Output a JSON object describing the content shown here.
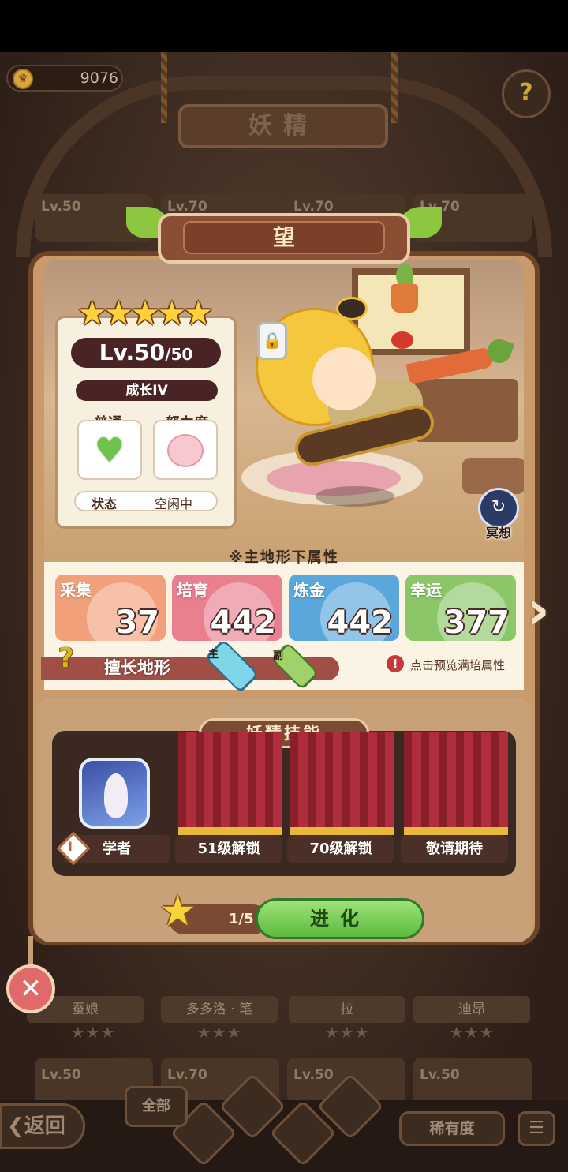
{
  "top_bar": {
    "coins": "9076"
  },
  "page_title": "妖精",
  "background_cards": {
    "top_row_levels": [
      "Lv.50",
      "Lv.70",
      "Lv.70",
      "Lv.70"
    ],
    "middle_row_names": [
      "蚕娘",
      "多多洛 · 笔",
      "拉",
      "迪昂"
    ],
    "bottom_row_levels": [
      "Lv.50",
      "Lv.70",
      "Lv.50",
      "Lv.50"
    ],
    "stars": "★★★"
  },
  "fairy": {
    "name": "望",
    "stars": "★★★★★",
    "level": "Lv.50",
    "level_max": "/50",
    "growth": "成长IV",
    "rarity_label": "普通",
    "effort_label": "努力度",
    "status_label": "状态",
    "status_value": "空闲中",
    "meditate_label": "冥想"
  },
  "attributes": {
    "header": "※主地形下属性",
    "items": [
      {
        "label": "采集",
        "value": "37",
        "color": "#f2a07a"
      },
      {
        "label": "培育",
        "value": "442",
        "color": "#ea7f8f"
      },
      {
        "label": "炼金",
        "value": "442",
        "color": "#5aa7dc"
      },
      {
        "label": "幸运",
        "value": "377",
        "color": "#8bc767"
      }
    ],
    "terrain_label": "擅长地形",
    "terrain_main_tag": "主",
    "terrain_sub_tag": "副",
    "preview_label": "点击预览满培属性"
  },
  "skills": {
    "header": "妖精技能",
    "slots": [
      {
        "label": "学者",
        "tag": "I"
      },
      {
        "label": "51级解锁"
      },
      {
        "label": "70级解锁"
      },
      {
        "label": "敬请期待"
      }
    ]
  },
  "evolve": {
    "progress": "1/5",
    "button": "进化"
  },
  "bottom_nav": {
    "back": "返回",
    "all": "全部",
    "rarity": "稀有度"
  }
}
